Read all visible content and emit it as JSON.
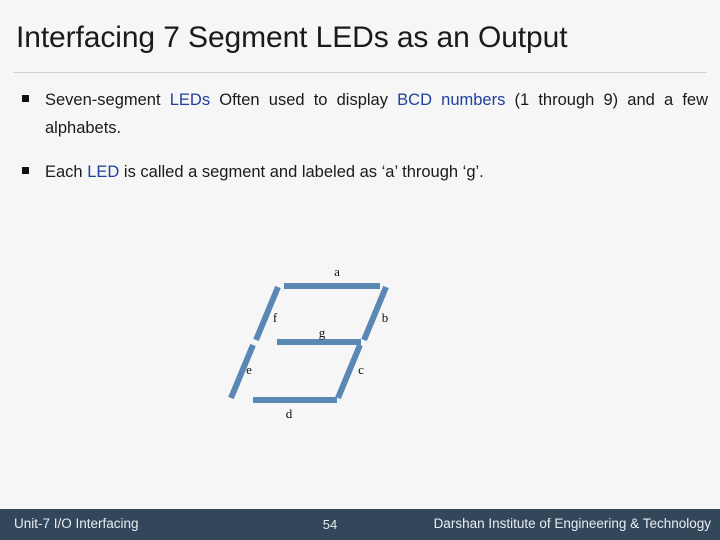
{
  "slide": {
    "title": "Interfacing 7 Segment LEDs as an Output",
    "background_color": "#f6f6f6",
    "accent_color": "#1f3f9e",
    "segment_color": "#5b87b5",
    "footer_color": "#33475b"
  },
  "bullets": [
    {
      "marker": "square-bullet",
      "parts": [
        {
          "text": "Seven-segment ",
          "highlight": false
        },
        {
          "text": "LEDs",
          "highlight": true
        },
        {
          "text": " Often used to display ",
          "highlight": false
        },
        {
          "text": "BCD numbers",
          "highlight": true
        },
        {
          "text": " (1 through 9) and a few alphabets.",
          "highlight": false
        }
      ],
      "justified": true
    },
    {
      "marker": "square-bullet",
      "parts": [
        {
          "text": "Each ",
          "highlight": false
        },
        {
          "text": "LED",
          "highlight": true
        },
        {
          "text": " is called a segment and labeled as ‘a’ through ‘g’.",
          "highlight": false
        }
      ],
      "justified": false
    }
  ],
  "diagram": {
    "name": "seven-segment-display",
    "segments": [
      {
        "id": "a",
        "label": "a"
      },
      {
        "id": "b",
        "label": "b"
      },
      {
        "id": "c",
        "label": "c"
      },
      {
        "id": "d",
        "label": "d"
      },
      {
        "id": "e",
        "label": "e"
      },
      {
        "id": "f",
        "label": "f"
      },
      {
        "id": "g",
        "label": "g"
      }
    ]
  },
  "footer": {
    "left": "Unit-7 I/O Interfacing",
    "page_number": "54",
    "right": "Darshan Institute of Engineering & Technology"
  }
}
